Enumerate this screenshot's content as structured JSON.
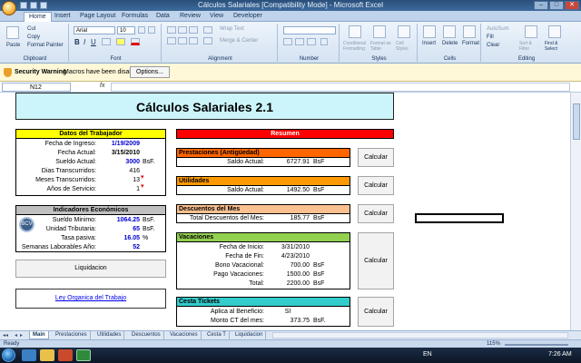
{
  "window": {
    "title": "Cálculos Salariales  [Compatibility Mode] - Microsoft Excel"
  },
  "ribbon": {
    "tabs": [
      "Home",
      "Insert",
      "Page Layout",
      "Formulas",
      "Data",
      "Review",
      "View",
      "Developer"
    ],
    "active_tab": "Home",
    "clipboard": {
      "paste": "Paste",
      "cut": "Cut",
      "copy": "Copy",
      "format_painter": "Format Painter",
      "label": "Clipboard"
    },
    "font": {
      "name": "Arial",
      "size": "10",
      "label": "Font"
    },
    "alignment": {
      "wrap_text": "Wrap Text",
      "merge_center": "Merge & Center",
      "label": "Alignment"
    },
    "number": {
      "label": "Number"
    },
    "styles": {
      "conditional": "Conditional Formatting",
      "format_table": "Format as Table",
      "cell_styles": "Cell Styles",
      "label": "Styles"
    },
    "cells": {
      "insert": "Insert",
      "delete": "Delete",
      "format": "Format",
      "label": "Cells"
    },
    "editing": {
      "autosum": "AutoSum",
      "fill": "Fill",
      "clear": "Clear",
      "sort_filter": "Sort & Filter",
      "find_select": "Find & Select",
      "label": "Editing"
    }
  },
  "security": {
    "title": "Security Warning",
    "message": "Macros have been disabled.",
    "options_button": "Options..."
  },
  "formula_bar": {
    "name_box": "N12",
    "fx": "fx",
    "value": ""
  },
  "sheet": {
    "title": "Cálculos Salariales 2.1",
    "datos": {
      "header": "Datos del Trabajador",
      "rows": [
        {
          "label": "Fecha de Ingreso:",
          "value": "1/19/2009",
          "unit": ""
        },
        {
          "label": "Fecha Actual:",
          "value": "3/15/2010",
          "unit": ""
        },
        {
          "label": "Sueldo Actual:",
          "value": "3000",
          "unit": "BsF."
        },
        {
          "label": "Dias Transcurridos:",
          "value": "416",
          "unit": ""
        },
        {
          "label": "Meses Transcurridos:",
          "value": "13",
          "unit": ""
        },
        {
          "label": "Años de Servicio:",
          "value": "1",
          "unit": ""
        }
      ]
    },
    "indicadores": {
      "header": "Indicadores Económicos",
      "seal": "BCV",
      "rows": [
        {
          "label": "Sueldo Minimo:",
          "value": "1064.25",
          "unit": "BsF."
        },
        {
          "label": "Unidad Tributaria:",
          "value": "65",
          "unit": "BsF."
        },
        {
          "label": "Tasa pasiva:",
          "value": "16.05",
          "unit": "%"
        },
        {
          "label": "Semanas Laborables Año:",
          "value": "52",
          "unit": ""
        }
      ]
    },
    "liquidacion_button": "Liquidacion",
    "ley_link": "Ley Organica del Trabajo",
    "resumen": {
      "header": "Resumen",
      "calcular": "Calcular",
      "prestaciones": {
        "header": "Prestaciones (Antigüedad)",
        "label": "Saldo Actual:",
        "value": "6727.91",
        "unit": "BsF"
      },
      "utilidades": {
        "header": "Utilidades",
        "label": "Saldo Actual:",
        "value": "1492.50",
        "unit": "BsF"
      },
      "descuentos": {
        "header": "Descuentos del Mes",
        "label": "Total Descuentos del Mes:",
        "value": "185.77",
        "unit": "BsF"
      },
      "vacaciones": {
        "header": "Vacaciones",
        "rows": [
          {
            "label": "Fecha de Inicio:",
            "value": "3/31/2010",
            "unit": ""
          },
          {
            "label": "Fecha de Fin:",
            "value": "4/23/2010",
            "unit": ""
          },
          {
            "label": "Bono Vacacional:",
            "value": "700.00",
            "unit": "BsF"
          },
          {
            "label": "Pago Vacaciones:",
            "value": "1500.00",
            "unit": "BsF"
          },
          {
            "label": "Total:",
            "value": "2200.00",
            "unit": "BsF"
          }
        ]
      },
      "cesta": {
        "header": "Cesta Tickets",
        "rows": [
          {
            "label": "Aplica al Beneficio:",
            "value": "SI",
            "unit": ""
          },
          {
            "label": "Monto CT del mes:",
            "value": "373.75",
            "unit": "BsF."
          }
        ]
      }
    }
  },
  "sheet_tabs": [
    "Main",
    "Prestaciones",
    "Utilidades",
    "Descuentos",
    "Vacaciones",
    "Cesta T",
    "Liquidacion"
  ],
  "active_sheet": "Main",
  "status": {
    "ready": "Ready",
    "zoom": "115%"
  },
  "taskbar": {
    "lang": "EN",
    "time": "7:26 AM"
  },
  "colors": {
    "datos_header": "#ffff00",
    "indicadores_header": "#c0c0c0",
    "resumen_header": "#ff0000",
    "prestaciones_header": "#ff6600",
    "utilidades_header": "#ff9900",
    "descuentos_header": "#fac090",
    "vacaciones_header": "#92d050",
    "cesta_header": "#33cccc",
    "banner": "#ccf5fb"
  }
}
